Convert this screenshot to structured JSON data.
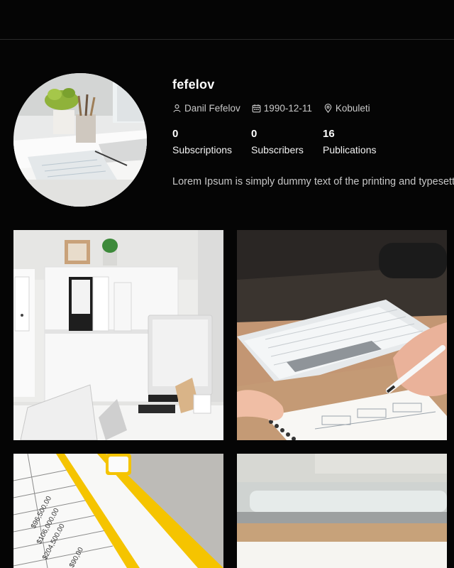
{
  "profile": {
    "username": "fefelov",
    "full_name": "Danil Fefelov",
    "birth_date": "1990-12-11",
    "location": "Kobuleti",
    "bio": "Lorem Ipsum is simply dummy text of the printing and typesetting industry."
  },
  "stats": [
    {
      "value": "0",
      "label": "Subscriptions"
    },
    {
      "value": "0",
      "label": "Subscribers"
    },
    {
      "value": "16",
      "label": "Publications"
    }
  ],
  "icons": {
    "name": "user-icon",
    "birth_date": "calendar-icon",
    "location": "map-pin-icon"
  },
  "photo_text": {
    "spreadsheet": [
      "$96,500.00",
      "$106,000.00",
      "$204,500.00",
      "$90,00"
    ]
  },
  "colors": {
    "background": "#050505",
    "text": "#ffffff",
    "muted_text": "#c9c9c9",
    "folder_yellow": "#f5c400"
  }
}
